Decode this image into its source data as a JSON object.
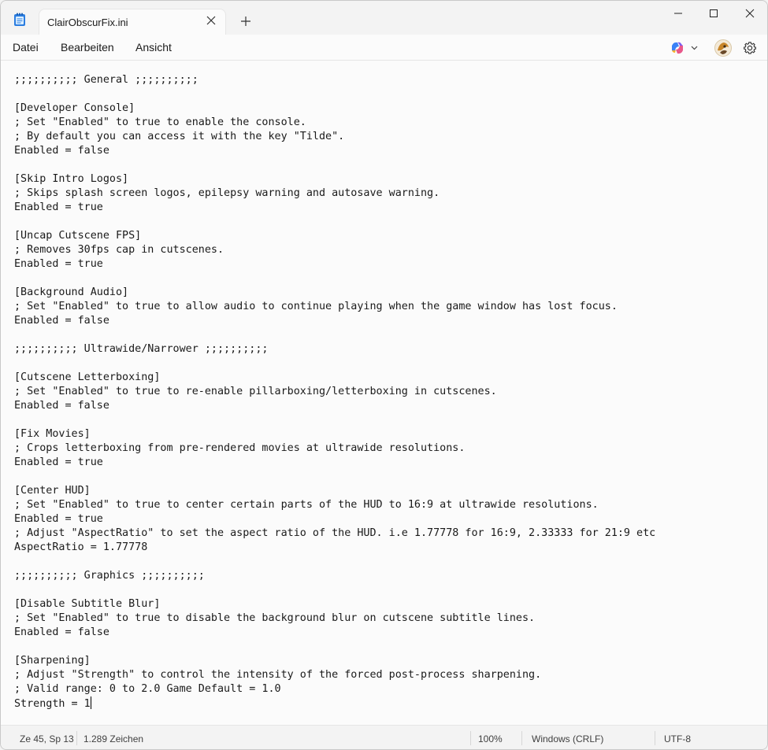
{
  "tab": {
    "title": "ClairObscurFix.ini"
  },
  "menu": {
    "items": [
      "Datei",
      "Bearbeiten",
      "Ansicht"
    ]
  },
  "icons": {
    "app": "notepad-icon",
    "copilot": "copilot-icon",
    "avatar": "profile-avatar",
    "settings": "gear-icon"
  },
  "editor": {
    "lines": [
      ";;;;;;;;;; General ;;;;;;;;;;",
      "",
      "[Developer Console]",
      "; Set \"Enabled\" to true to enable the console.",
      "; By default you can access it with the key \"Tilde\".",
      "Enabled = false",
      "",
      "[Skip Intro Logos]",
      "; Skips splash screen logos, epilepsy warning and autosave warning.",
      "Enabled = true",
      "",
      "[Uncap Cutscene FPS]",
      "; Removes 30fps cap in cutscenes.",
      "Enabled = true",
      "",
      "[Background Audio]",
      "; Set \"Enabled\" to true to allow audio to continue playing when the game window has lost focus.",
      "Enabled = false",
      "",
      ";;;;;;;;;; Ultrawide/Narrower ;;;;;;;;;;",
      "",
      "[Cutscene Letterboxing]",
      "; Set \"Enabled\" to true to re-enable pillarboxing/letterboxing in cutscenes.",
      "Enabled = false",
      "",
      "[Fix Movies]",
      "; Crops letterboxing from pre-rendered movies at ultrawide resolutions.",
      "Enabled = true",
      "",
      "[Center HUD]",
      "; Set \"Enabled\" to true to center certain parts of the HUD to 16:9 at ultrawide resolutions.",
      "Enabled = true",
      "; Adjust \"AspectRatio\" to set the aspect ratio of the HUD. i.e 1.77778 for 16:9, 2.33333 for 21:9 etc",
      "AspectRatio = 1.77778",
      "",
      ";;;;;;;;;; Graphics ;;;;;;;;;;",
      "",
      "[Disable Subtitle Blur]",
      "; Set \"Enabled\" to true to disable the background blur on cutscene subtitle lines.",
      "Enabled = false",
      "",
      "[Sharpening]",
      "; Adjust \"Strength\" to control the intensity of the forced post-process sharpening.",
      "; Valid range: 0 to 2.0 Game Default = 1.0",
      "Strength = 1"
    ]
  },
  "status": {
    "position": "Ze 45, Sp 13",
    "chars": "1.289 Zeichen",
    "zoom": "100%",
    "line_ending": "Windows (CRLF)",
    "encoding": "UTF-8"
  }
}
